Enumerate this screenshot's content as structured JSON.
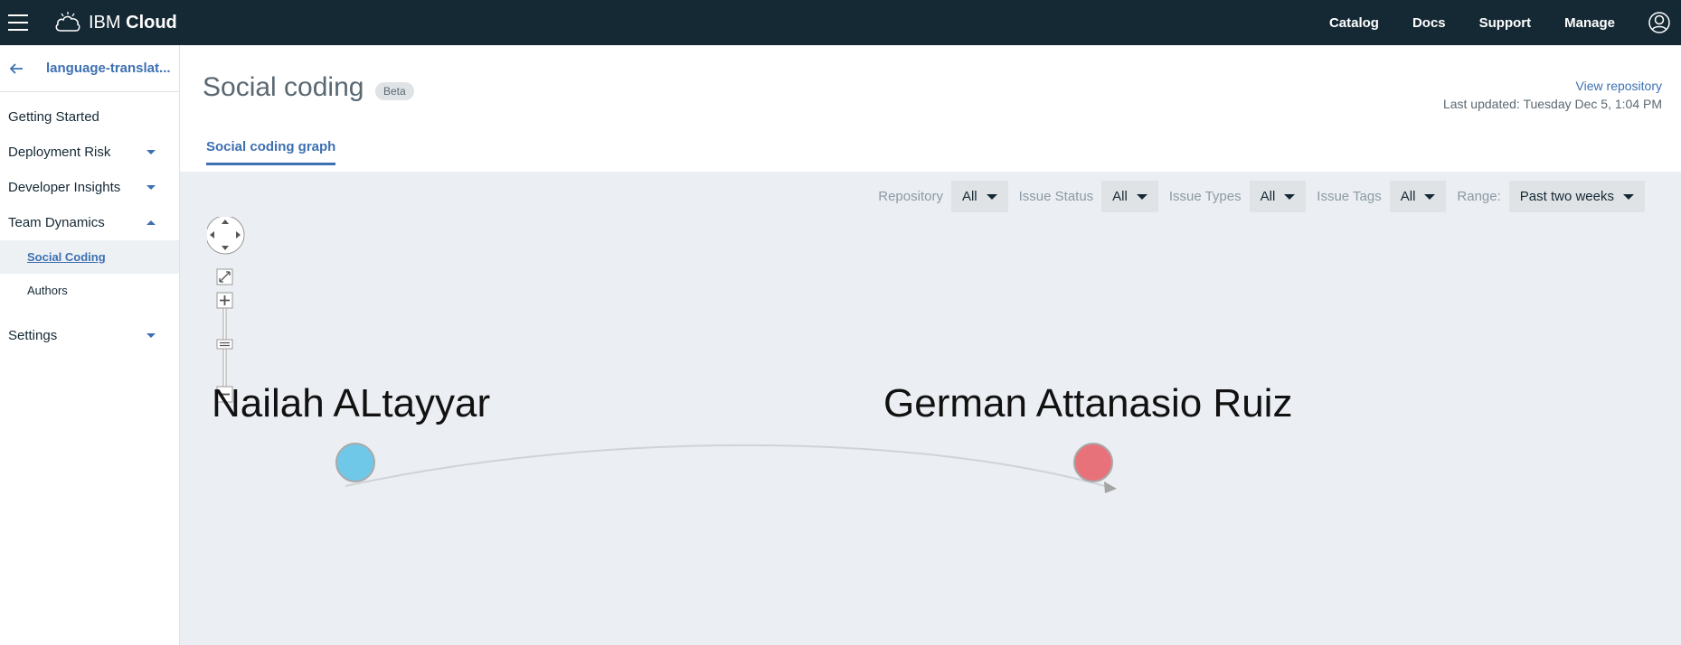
{
  "topbar": {
    "brand_plain": "IBM ",
    "brand_bold": "Cloud",
    "nav": [
      "Catalog",
      "Docs",
      "Support",
      "Manage"
    ],
    "icons": {
      "menu": "hamburger-icon",
      "logo": "cloud-icon",
      "account": "avatar-icon"
    }
  },
  "sidebar": {
    "app_name": "language-translat...",
    "items": [
      {
        "label": "Getting Started",
        "caret": "none"
      },
      {
        "label": "Deployment Risk",
        "caret": "down"
      },
      {
        "label": "Developer Insights",
        "caret": "down"
      },
      {
        "label": "Team Dynamics",
        "caret": "up"
      }
    ],
    "sub_items": [
      {
        "label": "Social Coding",
        "active": true
      },
      {
        "label": "Authors",
        "active": false
      }
    ],
    "settings_label": "Settings"
  },
  "header": {
    "title": "Social coding",
    "badge": "Beta",
    "view_repository": "View repository",
    "last_updated": "Last updated: Tuesday Dec 5, 1:04 PM",
    "tab": "Social coding graph"
  },
  "filters": [
    {
      "label": "Repository",
      "value": "All"
    },
    {
      "label": "Issue Status",
      "value": "All"
    },
    {
      "label": "Issue Types",
      "value": "All"
    },
    {
      "label": "Issue Tags",
      "value": "All"
    },
    {
      "label": "Range:",
      "value": "Past two weeks"
    }
  ],
  "graph": {
    "nodes": [
      {
        "name": "Nailah ALtayyar",
        "color": "#6fc8e8"
      },
      {
        "name": "German Attanasio Ruiz",
        "color": "#e8727a"
      }
    ],
    "edge": {
      "from": "Nailah ALtayyar",
      "to": "German Attanasio Ruiz"
    }
  },
  "colors": {
    "topbar": "#152935",
    "accent": "#3d70b2",
    "graph_bg": "#ebeef2"
  }
}
